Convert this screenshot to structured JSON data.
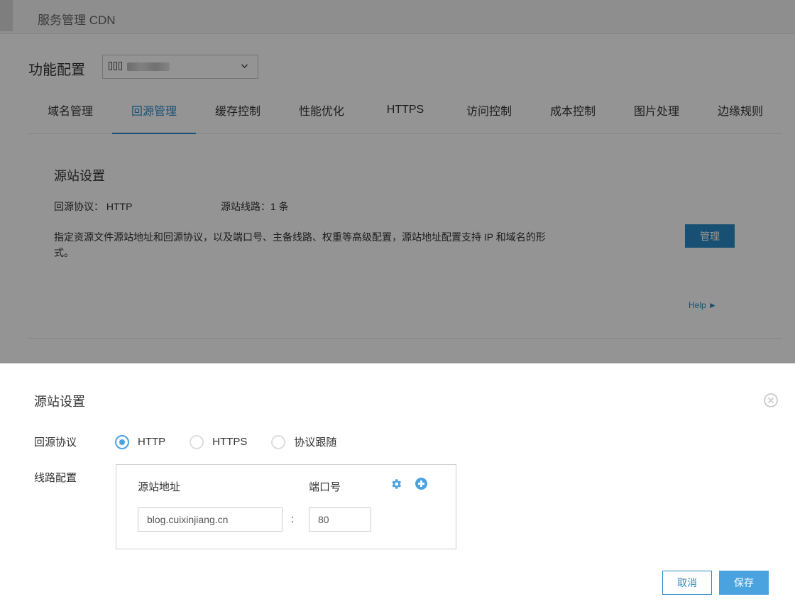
{
  "header": {
    "title": "服务管理 CDN"
  },
  "config": {
    "title": "功能配置",
    "domain_select": {
      "icon": "server-icon",
      "value_obscured": true
    }
  },
  "tabs": [
    {
      "label": "域名管理",
      "active": false
    },
    {
      "label": "回源管理",
      "active": true
    },
    {
      "label": "缓存控制",
      "active": false
    },
    {
      "label": "性能优化",
      "active": false
    },
    {
      "label": "HTTPS",
      "active": false
    },
    {
      "label": "访问控制",
      "active": false
    },
    {
      "label": "成本控制",
      "active": false
    },
    {
      "label": "图片处理",
      "active": false
    },
    {
      "label": "边缘规则",
      "active": false
    }
  ],
  "origin": {
    "title": "源站设置",
    "protocol_text": "回源协议： HTTP",
    "lines_text": "源站线路：1 条",
    "description": "指定资源文件源站地址和回源协议，以及端口号、主备线路、权重等高级配置，源站地址配置支持 IP 和域名的形式。",
    "manage_label": "管理",
    "help_label": "Help ►"
  },
  "dialog": {
    "title": "源站设置",
    "protocol_label": "回源协议",
    "protocol_options": [
      {
        "label": "HTTP",
        "checked": true
      },
      {
        "label": "HTTPS",
        "checked": false
      },
      {
        "label": "协议跟随",
        "checked": false
      }
    ],
    "line_label": "线路配置",
    "address_col": "源站地址",
    "port_col": "端口号",
    "address_value": "blog.cuixinjiang.cn",
    "separator": ":",
    "port_value": "80",
    "cancel_label": "取消",
    "save_label": "保存"
  },
  "colors": {
    "accent": "#2a8bc6",
    "accent_light": "#4aa3df",
    "overlay": "rgba(0,0,0,0.42)"
  }
}
